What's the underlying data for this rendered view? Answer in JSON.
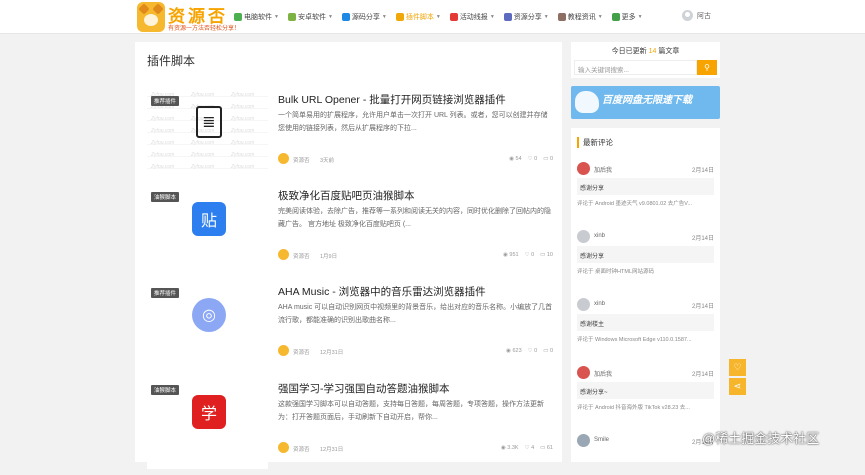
{
  "logo": {
    "name": "资源否",
    "slogan": "有资源一方法否轻松分享！"
  },
  "nav": [
    {
      "label": "电脑软件",
      "color": "#4caf50",
      "active": false
    },
    {
      "label": "安卓软件",
      "color": "#7cb342",
      "active": false
    },
    {
      "label": "源码分享",
      "color": "#1e88e5",
      "active": false
    },
    {
      "label": "插件脚本",
      "color": "#f0a70a",
      "active": true
    },
    {
      "label": "活动线报",
      "color": "#e53935",
      "active": false
    },
    {
      "label": "资源分享",
      "color": "#5c6bc0",
      "active": false
    },
    {
      "label": "教程资讯",
      "color": "#8d6e63",
      "active": false
    },
    {
      "label": "更多",
      "color": "#43a047",
      "active": false
    }
  ],
  "user": {
    "name": "阿古"
  },
  "main": {
    "title": "插件脚本",
    "posts": [
      {
        "badge": "推荐插件",
        "title": "Bulk URL Opener - 批量打开网页链接浏览器插件",
        "desc": "一个简单易用的扩展程序，允许用户单击一次打开 URL 列表。或者，您可以创建并存储您使用的链接列表，然后从扩展程序的下拉...",
        "author": "资源否",
        "date": "3天前",
        "views": "54",
        "likes": "0",
        "comments": "0",
        "icon": "doc-icon",
        "icon_bg": "#ffffff",
        "wm": true
      },
      {
        "badge": "油猴脚本",
        "title": "极致净化百度贴吧页油猴脚本",
        "desc": "完美阅读体验，去除广告，推荐等一系列和阅读无关的内容，同时优化删除了回帖内的隐藏广告。 官方地址 极致净化百度贴吧页 (...",
        "author": "资源否",
        "date": "1月9日",
        "views": "951",
        "likes": "0",
        "comments": "10",
        "icon": "tieba-icon",
        "icon_bg": "#2d7ff0",
        "wm": false
      },
      {
        "badge": "推荐插件",
        "title": "AHA Music - 浏览器中的音乐雷达浏览器插件",
        "desc": "AHA music 可以自动识别网页中视频里的背景音乐，给出对应的音乐名称。小编放了几首流行歌，都能准确的识别出歌曲名称...",
        "author": "资源否",
        "date": "12月31日",
        "views": "623",
        "likes": "0",
        "comments": "0",
        "icon": "music-search-icon",
        "icon_bg": "#8ca8f5",
        "wm": false
      },
      {
        "badge": "油猴脚本",
        "title": "强国学习-学习强国自动答题油猴脚本",
        "desc": "这款强国学习脚本可以自动答题，支持每日答题，每周答题，专项答题，操作方法更新为：打开答题页面后，手动刷新下自动开启，帮你...",
        "author": "资源否",
        "date": "12月31日",
        "views": "3.3K",
        "likes": "4",
        "comments": "61",
        "icon": "xuexi-icon",
        "icon_bg": "#e02020",
        "wm": false
      }
    ]
  },
  "sidebar": {
    "update_prefix": "今日已更新 ",
    "update_count": "14",
    "update_suffix": " 篇文章",
    "search_placeholder": "输入关键词搜索...",
    "banner_title": "百度网盘无限速下载",
    "banner_sub": "",
    "comments_title": "最新评论",
    "comments": [
      {
        "name": "加后我",
        "date": "2月14日",
        "text": "感谢分享",
        "src": "评论于 Android 墨迹天气 v9.0801.02 去广告V...",
        "avatar_color": "#d9534f"
      },
      {
        "name": "xinb",
        "date": "2月14日",
        "text": "感谢分享",
        "src": "评论于 桌面时钟HTML网站源码",
        "avatar_color": "#c8cbd0"
      },
      {
        "name": "xinb",
        "date": "2月14日",
        "text": "感谢楼主",
        "src": "评论于 Windows Microsoft Edge v110.0.1587...",
        "avatar_color": "#c8cbd0"
      },
      {
        "name": "加后我",
        "date": "2月14日",
        "text": "感谢分享~",
        "src": "评论于 Android 抖音海外版 TikTok v28.23 去...",
        "avatar_color": "#d9534f"
      },
      {
        "name": "Smile",
        "date": "2月14日",
        "text": "",
        "src": "",
        "avatar_color": "#9aa8b5"
      }
    ]
  },
  "watermark": "@稀土掘金技术社区"
}
